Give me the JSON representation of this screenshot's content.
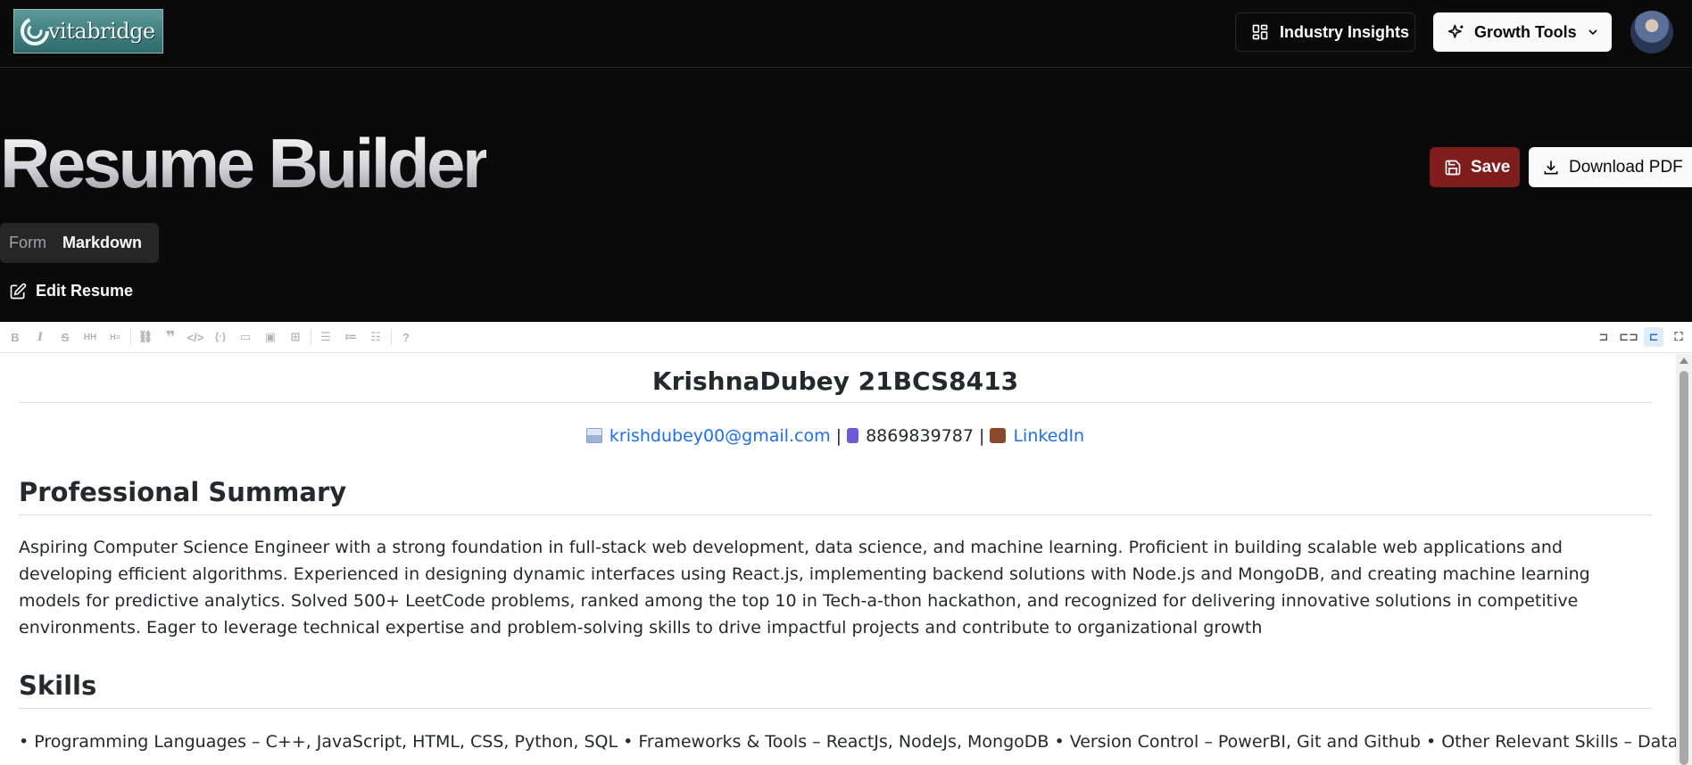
{
  "nav": {
    "logo_text": "vitabridge",
    "industry_insights_label": "Industry Insights",
    "growth_tools_label": "Growth Tools"
  },
  "page": {
    "title": "Resume Builder",
    "save_label": "Save",
    "download_label": "Download PDF",
    "tabs": [
      {
        "label": "Form",
        "active": false
      },
      {
        "label": "Markdown",
        "active": true
      }
    ],
    "edit_label": "Edit Resume"
  },
  "editor": {
    "toolbar_left": [
      "bold-icon",
      "italic-icon",
      "strikethrough-icon",
      "heading-icon",
      "heading-small-icon",
      "|",
      "link-icon",
      "quote-icon",
      "code-icon",
      "code-block-icon",
      "comment-icon",
      "image-icon",
      "table-icon",
      "|",
      "unordered-list-icon",
      "ordered-list-icon",
      "checklist-icon",
      "|",
      "help-icon"
    ],
    "toolbar_right": [
      "edit-mode-icon",
      "live-mode-icon",
      "preview-mode-icon",
      "fullscreen-icon"
    ],
    "active_mode": "preview-mode-icon"
  },
  "resume": {
    "name": "KrishnaDubey 21BCS8413",
    "email": "krishdubey00@gmail.com",
    "separator": "|",
    "phone": "8869839787",
    "linkedin": "LinkedIn",
    "summary_heading": "Professional Summary",
    "summary": "Aspiring Computer Science Engineer with a strong foundation in full-stack web development, data science, and machine learning. Proficient in building scalable web applications and developing efficient algorithms. Experienced in designing dynamic interfaces using React.js, implementing backend solutions with Node.js and MongoDB, and creating machine learning models for predictive analytics. Solved 500+ LeetCode problems, ranked among the top 10 in Tech-a-thon hackathon, and recognized for delivering innovative solutions in competitive environments. Eager to leverage technical expertise and problem-solving skills to drive impactful projects and contribute to organizational growth",
    "skills_heading": "Skills",
    "skills": "• Programming Languages – C++, JavaScript, HTML, CSS, Python, SQL • Frameworks & Tools – ReactJs, NodeJs, MongoDB • Version Control – PowerBI, Git and Github • Other Relevant Skills – Data Structures"
  }
}
